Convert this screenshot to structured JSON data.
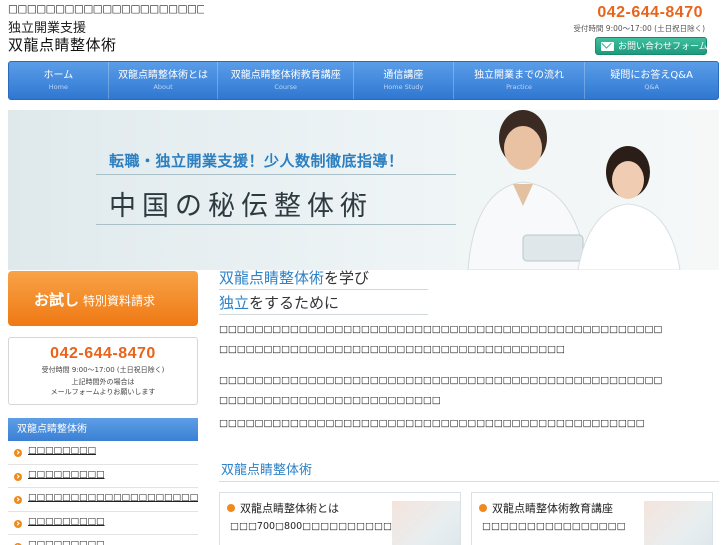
{
  "header": {
    "tagline": "□□□□□□□□□□□□□□□□□□□□□□□□□□□□□□□□□□",
    "logo_sub": "独立開業支援",
    "logo_main": "双龍点睛整体術",
    "phone": "042-644-8470",
    "hours": "受付時間 9:00〜17:00 (土日祝日除く)",
    "contact_button": "お問い合わせフォーム"
  },
  "nav": [
    {
      "jp": "ホーム",
      "en": "Home"
    },
    {
      "jp": "双龍点睛整体術とは",
      "en": "About"
    },
    {
      "jp": "双龍点睛整体術教育講座",
      "en": "Course"
    },
    {
      "jp": "通信講座",
      "en": "Home Study"
    },
    {
      "jp": "独立開業までの流れ",
      "en": "Practice"
    },
    {
      "jp": "疑問にお答えQ&A",
      "en": "Q&A"
    }
  ],
  "hero": {
    "lead": "転職・独立開業支援！少人数制徹底指導！",
    "title": "中国の秘伝整体術"
  },
  "sidebar": {
    "trial_bold": "お試し",
    "trial_rest": "特別資料請求",
    "phone": "042-644-8470",
    "hours": "受付時間 9:00〜17:00 (土日祝日除く)",
    "note1": "上記時間外の場合は",
    "note2": "メールフォームよりお願いします",
    "menu_title": "双龍点睛整体術",
    "menu": [
      "□□□□□□□□",
      "□□□□□□□□□",
      "□□□□□□□□□□□□□□□□□□□□",
      "□□□□□□□□□",
      "□□□□□□□□□"
    ]
  },
  "main": {
    "h1_highlight": "双龍点睛整体術",
    "h1_rest": "を学び",
    "h2_highlight": "独立",
    "h2_rest": "をするために",
    "para1_line1": "□□□□□□□□□□□□□□□□□□□□□□□□□□□□□□□□□□□□□□□□□□□□□□□□□□",
    "para1_line2": "□□□□□□□□□□□□□□□□□□□□□□□□□□□□□□□□□□□□□□□",
    "para2_line1": "□□□□□□□□□□□□□□□□□□□□□□□□□□□□□□□□□□□□□□□□□□□□□□□□□□",
    "para2_line2": "□□□□□□□□□□□□□□□□□□□□□□□□□",
    "para3_line1": "□□□□□□□□□□□□□□□□□□□□□□□□□□□□□□□□□□□□□□□□□□□□□□□□",
    "section_title": "双龍点睛整体術",
    "cards": [
      {
        "title": "双龍点睛整体術とは",
        "body": "□□□700□800□□□□□□□□□□□□□"
      },
      {
        "title": "双龍点睛整体術教育講座",
        "body": "□□□□□□□□□□□□□□□□"
      }
    ]
  }
}
